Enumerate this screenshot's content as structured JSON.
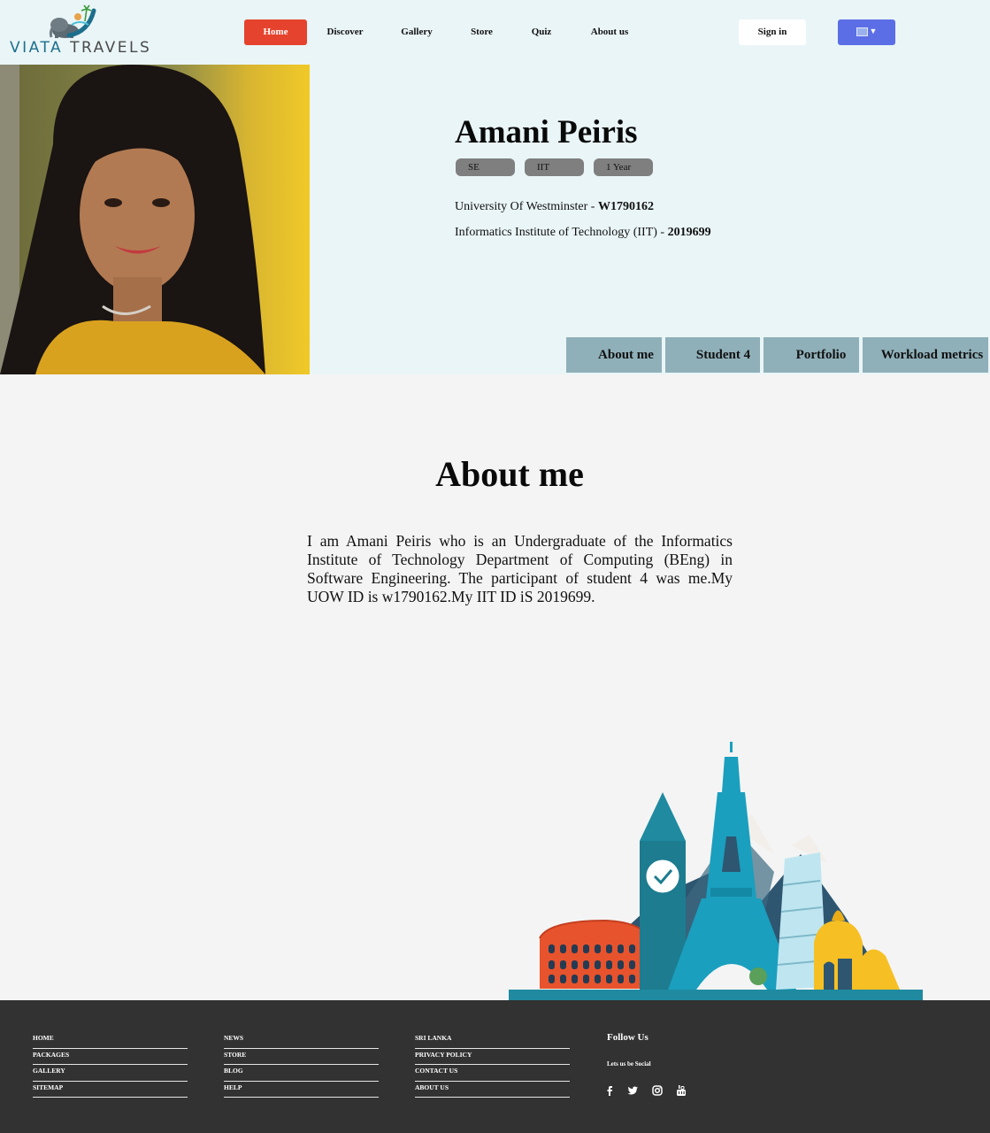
{
  "brand": {
    "name_part1": "VIATA",
    "name_part2": "TRAVELS"
  },
  "nav": {
    "items": [
      "Home",
      "Discover",
      "Gallery",
      "Store",
      "Quiz",
      "About us"
    ],
    "sign_in": "Sign in",
    "lang_caret": "▼"
  },
  "profile": {
    "name": "Amani Peiris",
    "tags": [
      "SE",
      "IIT",
      "1 Year"
    ],
    "uni1_text": "University Of Westminster - ",
    "uni1_id": "W1790162",
    "uni2_text": "Informatics Institute of Technology (IIT) - ",
    "uni2_id": "2019699"
  },
  "tabs": [
    "About me",
    "Student 4",
    "Portfolio",
    "Workload metrics"
  ],
  "about": {
    "title": "About me",
    "text": "I am Amani Peiris who is an Undergraduate of the Informatics Institute of Technology Department of Computing (BEng) in Software Engineering. The participant of student 4 was me.My UOW ID is w1790162.My IIT ID iS 2019699."
  },
  "footer": {
    "col1": [
      "HOME",
      "PACKAGES",
      "GALLERY",
      "SITEMAP"
    ],
    "col2": [
      "NEWS",
      "STORE",
      "BLOG",
      "HELP"
    ],
    "col3": [
      "SRI LANKA",
      "PRIVACY POLICY",
      "CONTACT US",
      "ABOUT US"
    ],
    "follow_title": "Follow Us",
    "follow_sub": "Lets us be Social",
    "social_icons": [
      "facebook-icon",
      "twitter-icon",
      "instagram-icon",
      "youtube-icon"
    ]
  },
  "colors": {
    "accent_red": "#e5432d",
    "lang_button": "#5c6ee6",
    "tab_bg": "#8fb0b9",
    "hero_bg": "#eaf5f7",
    "footer_bg": "#323232"
  }
}
